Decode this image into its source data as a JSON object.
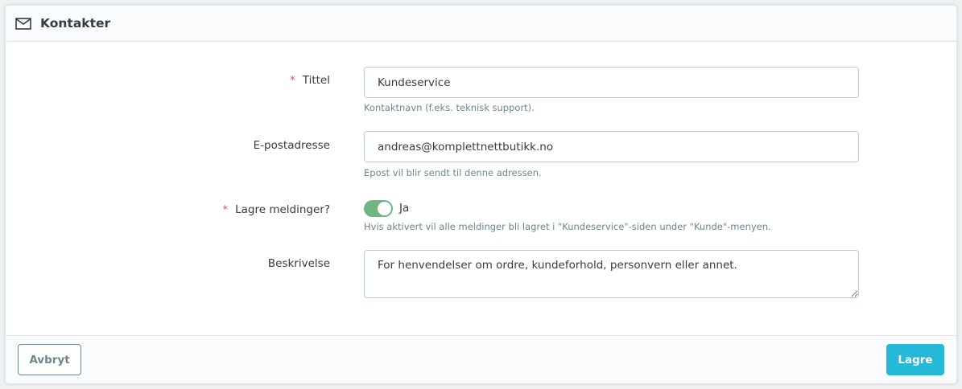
{
  "header": {
    "title": "Kontakter",
    "icon": "envelope-icon"
  },
  "form": {
    "title_field": {
      "required_mark": "*",
      "label": "Tittel",
      "value": "Kundeservice",
      "help": "Kontaktnavn (f.eks. teknisk support)."
    },
    "email_field": {
      "label": "E-postadresse",
      "value": "andreas@komplettnettbutikk.no",
      "help": "Epost vil blir sendt til denne adressen."
    },
    "save_messages": {
      "required_mark": "*",
      "label": "Lagre meldinger?",
      "state": "on",
      "state_label": "Ja",
      "help": "Hvis aktivert vil alle meldinger bli lagret i \"Kundeservice\"-siden under \"Kunde\"-menyen."
    },
    "description_field": {
      "label": "Beskrivelse",
      "value": "For henvendelser om ordre, kundeforhold, personvern eller annet."
    }
  },
  "footer": {
    "cancel_label": "Avbryt",
    "save_label": "Lagre"
  },
  "colors": {
    "accent": "#25b9d7",
    "switch_on": "#70b580",
    "required": "#e84d4d"
  }
}
